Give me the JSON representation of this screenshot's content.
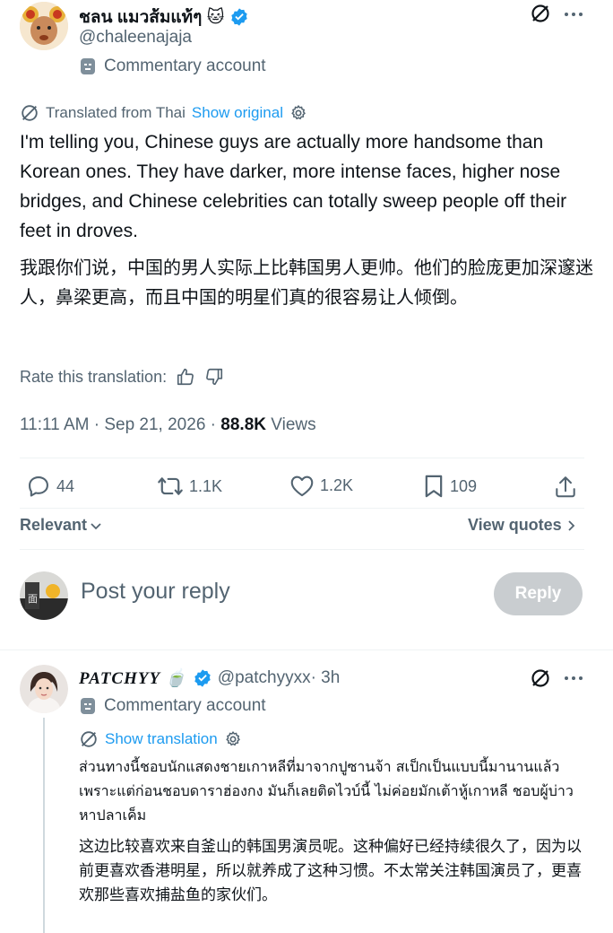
{
  "post": {
    "display_name": "ชลน แมวส้มแท้ๆ 🐱",
    "handle": "@chaleenajaja",
    "account_label": "Commentary account",
    "translated_from": "Translated from Thai",
    "show_original": "Show original",
    "translation": "I'm telling you, Chinese guys are actually more handsome than Korean ones. They have darker, more intense faces, higher nose bridges, and Chinese celebrities can totally sweep people off their feet in droves.",
    "translation_zh": "我跟你们说，中国的男人实际上比韩国男人更帅。他们的脸庞更加深邃迷人，鼻梁更高，而且中国的明星们真的很容易让人倾倒。",
    "rate_label": "Rate this translation:",
    "timestamp": "11:11 AM · Sep 21, 2026 · ",
    "views_count": "88.8K",
    "views_label": " Views"
  },
  "stats": {
    "replies": "44",
    "reposts": "1.1K",
    "likes": "1.2K",
    "bookmarks": "109"
  },
  "sort": {
    "relevant": "Relevant",
    "view_quotes": "View quotes"
  },
  "composer": {
    "placeholder": "Post your reply",
    "button": "Reply"
  },
  "reply": {
    "display_name": "PATCHYY 🍵",
    "handle": "@patchyyxx",
    "time": " · 3h",
    "account_label": "Commentary account",
    "show_translation": "Show translation",
    "text_th": "ส่วนทางนี้ชอบนักแสดงชายเกาหลีที่มาจากปูซานจ้า สเป็กเป็นแบบนี้มานานแล้วเพราะแต่ก่อนชอบดาราฮ่องกง มันก็เลยติดไวบ์นี้ ไม่ค่อยมักเต้าหู้เกาหลี ชอบผู้บ่าวหาปลาเค็ม",
    "text_zh": "这边比较喜欢来自釜山的韩国男演员呢。这种偏好已经持续很久了，因为以前更喜欢香港明星，所以就养成了这种习惯。不太常关注韩国演员了，更喜欢那些喜欢捕盐鱼的家伙们。"
  },
  "colors": {
    "accent": "#1d9bf0",
    "muted": "#536471",
    "text": "#0f1419",
    "reply_button": "#c9cdd0",
    "verified": "#1d9bf0"
  },
  "icons": [
    "grok-icon",
    "more-icon",
    "verified-badge-icon",
    "commentary-icon",
    "translate-icon",
    "gear-icon",
    "thumbs-up-icon",
    "thumbs-down-icon",
    "reply-icon",
    "repost-icon",
    "like-icon",
    "bookmark-icon",
    "share-icon",
    "chevron-down-icon",
    "chevron-right-icon"
  ]
}
